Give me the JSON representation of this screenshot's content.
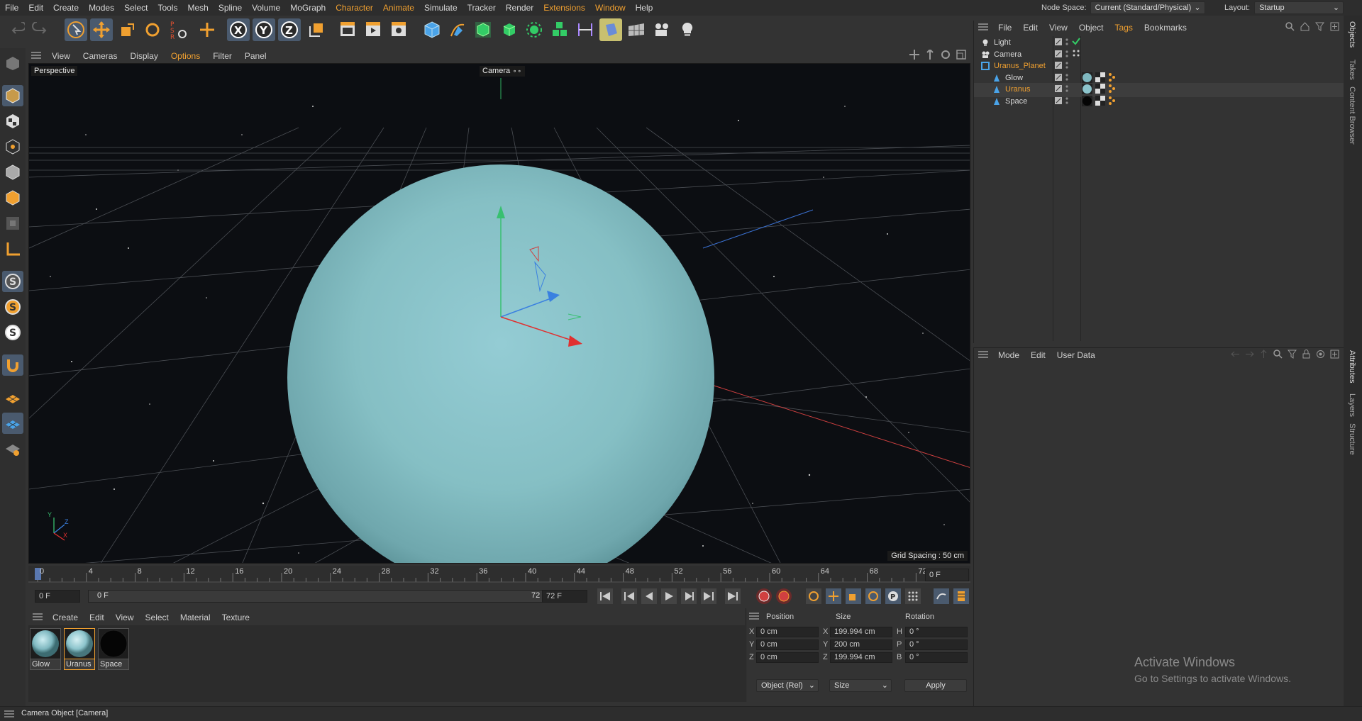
{
  "menubar": {
    "items": [
      "File",
      "Edit",
      "Create",
      "Modes",
      "Select",
      "Tools",
      "Mesh",
      "Spline",
      "Volume",
      "MoGraph",
      "Character",
      "Animate",
      "Simulate",
      "Tracker",
      "Render",
      "Extensions",
      "Window",
      "Help"
    ],
    "node_space_label": "Node Space:",
    "node_space_value": "Current (Standard/Physical)",
    "layout_label": "Layout:",
    "layout_value": "Startup"
  },
  "viewport": {
    "menu": [
      "View",
      "Cameras",
      "Display",
      "Options",
      "Filter",
      "Panel"
    ],
    "view_name": "Perspective",
    "camera_label": "Camera",
    "grid_spacing": "Grid Spacing : 50 cm",
    "axis_labels": {
      "y": "Y",
      "z": "Z",
      "x": "X"
    }
  },
  "timeline": {
    "ticks": [
      "0",
      "4",
      "8",
      "12",
      "16",
      "20",
      "24",
      "28",
      "32",
      "36",
      "40",
      "44",
      "48",
      "52",
      "56",
      "60",
      "64",
      "68",
      "72"
    ],
    "current_frame": "0 F",
    "start_field": "0 F",
    "range_start": "0 F",
    "range_end": "72 F",
    "end_field": "72 F"
  },
  "material_manager": {
    "menu": [
      "Create",
      "Edit",
      "View",
      "Select",
      "Material",
      "Texture"
    ],
    "materials": [
      {
        "name": "Glow",
        "color": "#7fb8c0"
      },
      {
        "name": "Uranus",
        "color": "#8cc4cc"
      },
      {
        "name": "Space",
        "color": "#050505"
      }
    ]
  },
  "coordinates": {
    "headers": [
      "Position",
      "Size",
      "Rotation"
    ],
    "rows": [
      {
        "axis": "X",
        "pos": "0 cm",
        "size_axis": "X",
        "size": "199.994 cm",
        "rot_axis": "H",
        "rot": "0 °"
      },
      {
        "axis": "Y",
        "pos": "0 cm",
        "size_axis": "Y",
        "size": "200 cm",
        "rot_axis": "P",
        "rot": "0 °"
      },
      {
        "axis": "Z",
        "pos": "0 cm",
        "size_axis": "Z",
        "size": "199.994 cm",
        "rot_axis": "B",
        "rot": "0 °"
      }
    ],
    "mode_dropdown": "Object (Rel)",
    "size_dropdown": "Size",
    "apply_label": "Apply"
  },
  "object_manager": {
    "menu": [
      "File",
      "Edit",
      "View",
      "Object",
      "Tags",
      "Bookmarks"
    ],
    "objects": [
      {
        "name": "Light",
        "color": "#d8d8d8"
      },
      {
        "name": "Camera",
        "color": "#d8d8d8"
      },
      {
        "name": "Uranus_Planet",
        "color": "#f0a030"
      },
      {
        "name": "Glow",
        "color": "#d8d8d8"
      },
      {
        "name": "Uranus",
        "color": "#f0a030"
      },
      {
        "name": "Space",
        "color": "#d8d8d8"
      }
    ]
  },
  "attribute_manager": {
    "menu": [
      "Mode",
      "Edit",
      "User Data"
    ]
  },
  "side_tabs": {
    "top": [
      "Objects",
      "Takes",
      "Content Browser"
    ],
    "bottom": [
      "Attributes",
      "Layers",
      "Structure"
    ]
  },
  "watermark": {
    "title": "Activate Windows",
    "subtitle": "Go to Settings to activate Windows."
  },
  "status": {
    "text": "Camera Object [Camera]"
  },
  "colors": {
    "accent": "#f0a030",
    "planet": "#8cc4cc",
    "active_tool": "#4a5a6e"
  }
}
